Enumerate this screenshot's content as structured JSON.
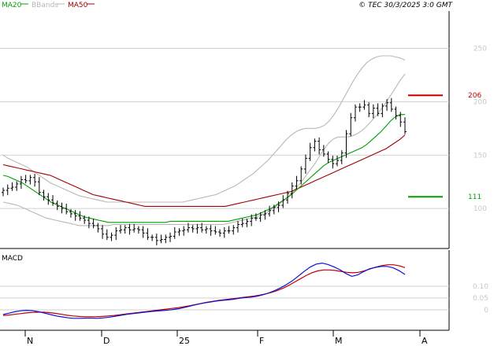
{
  "header": {
    "legend": [
      {
        "label": "MA20",
        "color": "#00a000"
      },
      {
        "label": "BBands",
        "color": "#b8b8b8"
      },
      {
        "label": "MA50",
        "color": "#a00000"
      }
    ],
    "copyright": "© TEC 30/3/2025 3:0 GMT"
  },
  "colors": {
    "price_bars": "#000000",
    "ma20": "#00a000",
    "ma50": "#a00000",
    "bbands": "#b8b8b8",
    "grid": "#d0d0d0",
    "axis_text": "#c8c8c8",
    "macd_line": "#1010d0",
    "signal_line": "#c00000"
  },
  "chart_data": [
    {
      "type": "line",
      "description_type": "ohlc-with-indicators",
      "yticks": [
        100,
        150,
        200,
        250
      ],
      "ylim": [
        64,
        285
      ],
      "xlabels": [
        "N",
        "D",
        "25",
        "F",
        "M",
        "A"
      ],
      "markers": [
        {
          "label": "206",
          "value": 206,
          "color": "#c00000"
        },
        {
          "label": "111",
          "value": 111,
          "color": "#00a000"
        }
      ],
      "ohlc": {
        "start": 117,
        "steps": [
          2,
          1,
          3,
          4,
          -1,
          3,
          -4,
          -10,
          -4,
          -3,
          -3,
          -3,
          -2,
          -3,
          -2,
          -2,
          -2,
          -2,
          -3,
          -2,
          -3,
          -5,
          -3,
          2,
          4,
          1,
          2,
          -2,
          1,
          -1,
          -3,
          -4,
          0,
          -3,
          1,
          2,
          1,
          4,
          1,
          1,
          2,
          -1,
          1,
          -2,
          1,
          -2,
          -1,
          -1,
          2,
          0,
          3,
          3,
          1,
          2,
          3,
          0,
          3,
          1,
          3,
          3,
          2,
          5,
          6,
          7,
          5,
          11,
          10,
          10,
          6,
          -8,
          -4,
          -5,
          -4,
          3,
          7,
          18,
          15,
          10,
          0,
          2,
          -8,
          5,
          -5,
          7,
          3,
          -6,
          -6,
          -6,
          -9
        ]
      },
      "ma20": {
        "start": 131,
        "steps": [
          -1,
          -2,
          -2,
          -2,
          -3,
          -3,
          -3,
          -3,
          -3,
          -3,
          -2,
          -2,
          -2,
          -2,
          -2,
          -2,
          -2,
          -1,
          -1,
          -1,
          -1,
          -1,
          0,
          0,
          0,
          0,
          0,
          0,
          0,
          0,
          0,
          0,
          0,
          0,
          1,
          0,
          0,
          0,
          0,
          0,
          0,
          0,
          0,
          0,
          0,
          0,
          0,
          1,
          1,
          1,
          1,
          1,
          1,
          2,
          2,
          2,
          3,
          3,
          3,
          3,
          4,
          4,
          4,
          4,
          4,
          4,
          4,
          3,
          2,
          2,
          2,
          2,
          2,
          2,
          2,
          3,
          4,
          4,
          4,
          5,
          5,
          4,
          2,
          0
        ]
      },
      "ma50": {
        "start": 141,
        "steps": [
          -1,
          -1,
          -1,
          -1,
          -1,
          -1,
          -1,
          -1,
          -1,
          -1,
          -2,
          -2,
          -2,
          -2,
          -2,
          -2,
          -2,
          -2,
          -2,
          -1,
          -1,
          -1,
          -1,
          -1,
          -1,
          -1,
          -1,
          -1,
          -1,
          -1,
          0,
          0,
          0,
          0,
          0,
          0,
          0,
          0,
          0,
          0,
          0,
          0,
          0,
          0,
          0,
          0,
          0,
          1,
          1,
          1,
          1,
          1,
          1,
          1,
          1,
          1,
          1,
          1,
          1,
          1,
          1,
          2,
          2,
          2,
          2,
          2,
          2,
          2,
          2,
          2,
          2,
          2,
          2,
          2,
          2,
          2,
          2,
          2,
          2,
          2,
          2,
          3,
          3,
          3,
          4
        ]
      },
      "bbands_upper": {
        "start": 150,
        "steps": [
          -3,
          -2,
          -2,
          -2,
          -2,
          -3,
          -3,
          -3,
          -3,
          -3,
          -2,
          -2,
          -2,
          -2,
          -2,
          -2,
          -1,
          -1,
          -1,
          -1,
          -1,
          -1,
          0,
          0,
          0,
          0,
          0,
          0,
          0,
          0,
          0,
          0,
          0,
          0,
          0,
          0,
          0,
          0,
          1,
          1,
          1,
          1,
          1,
          1,
          1,
          2,
          2,
          2,
          2,
          3,
          3,
          3,
          3,
          4,
          4,
          4,
          5,
          5,
          5,
          5,
          4,
          3,
          2,
          1,
          0,
          0,
          1,
          2,
          4,
          6,
          7,
          8,
          8,
          8,
          7,
          6,
          5,
          3,
          2,
          1,
          0,
          0,
          -1,
          -1,
          -2
        ]
      },
      "bbands_lower": {
        "start": 106,
        "steps": [
          -1,
          -1,
          -1,
          -2,
          -2,
          -2,
          -2,
          -2,
          -2,
          -1,
          -1,
          -1,
          -1,
          -1,
          -1,
          -1,
          0,
          0,
          0,
          0,
          0,
          0,
          1,
          0,
          0,
          0,
          0,
          0,
          0,
          0,
          0,
          0,
          0,
          0,
          0,
          0,
          0,
          0,
          0,
          0,
          0,
          0,
          0,
          0,
          0,
          0,
          1,
          1,
          1,
          1,
          1,
          1,
          1,
          2,
          2,
          3,
          3,
          3,
          4,
          4,
          5,
          5,
          6,
          6,
          6,
          7,
          7,
          6,
          4,
          2,
          0,
          0,
          1,
          2,
          3,
          4,
          5,
          5,
          6,
          6,
          7,
          7,
          7,
          6
        ]
      }
    },
    {
      "type": "line",
      "title": "MACD",
      "yticks": [
        0,
        0.05,
        0.1
      ],
      "ytick_labels": [
        "0",
        "0.05",
        "0.10"
      ],
      "ylim": [
        -0.08,
        0.24
      ],
      "macd": {
        "start": -0.02,
        "steps": [
          0.006,
          0.006,
          0.004,
          0.002,
          -0.002,
          -0.004,
          -0.006,
          -0.006,
          -0.006,
          -0.004,
          -0.004,
          -0.002,
          0,
          0.001,
          0,
          -0.001,
          0.002,
          0.003,
          0.004,
          0.004,
          0.004,
          0.003,
          0.003,
          0.003,
          0.003,
          0.002,
          0.002,
          0.002,
          0.003,
          0.004,
          0.006,
          0.006,
          0.006,
          0.005,
          0.004,
          0.004,
          0.003,
          0.002,
          0.003,
          0.004,
          0.003,
          0.002,
          0.004,
          0.006,
          0.008,
          0.01,
          0.012,
          0.014,
          0.016,
          0.02,
          0.02,
          0.018,
          0.012,
          0.004,
          -0.006,
          -0.01,
          -0.012,
          -0.016,
          -0.012,
          0.006,
          0.014,
          0.012,
          0.006,
          0.004,
          0,
          -0.006,
          -0.012,
          -0.016
        ]
      },
      "signal": {
        "start": -0.024,
        "steps": [
          0.002,
          0.003,
          0.003,
          0.003,
          0.002,
          0.001,
          0,
          -0.002,
          -0.003,
          -0.004,
          -0.004,
          -0.003,
          -0.002,
          -0.001,
          0,
          0,
          0.001,
          0.002,
          0.002,
          0.003,
          0.003,
          0.003,
          0.003,
          0.003,
          0.003,
          0.003,
          0.003,
          0.003,
          0.003,
          0.003,
          0.004,
          0.004,
          0.005,
          0.005,
          0.005,
          0.004,
          0.004,
          0.003,
          0.003,
          0.003,
          0.003,
          0.003,
          0.003,
          0.004,
          0.005,
          0.006,
          0.008,
          0.01,
          0.012,
          0.014,
          0.014,
          0.014,
          0.012,
          0.008,
          0.004,
          0,
          -0.002,
          -0.004,
          -0.004,
          -0.002,
          0.002,
          0.006,
          0.008,
          0.008,
          0.006,
          0.004,
          0,
          -0.004,
          -0.008
        ]
      }
    }
  ]
}
